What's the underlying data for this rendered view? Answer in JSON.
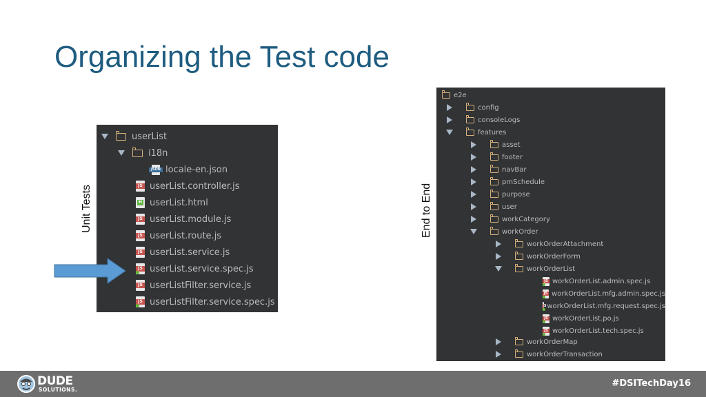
{
  "slide": {
    "title": "Organizing the Test code",
    "label_unit": "Unit Tests",
    "label_e2e": "End to End"
  },
  "panel_unit": {
    "items": [
      {
        "label": "userList",
        "icon": "folder",
        "expanded": true
      },
      {
        "label": "i18n",
        "icon": "folder",
        "expanded": true
      },
      {
        "label": "locale-en.json",
        "icon": "json-file"
      },
      {
        "label": "userList.controller.js",
        "icon": "js-file"
      },
      {
        "label": "userList.html",
        "icon": "html-file"
      },
      {
        "label": "userList.module.js",
        "icon": "js-file"
      },
      {
        "label": "userList.route.js",
        "icon": "js-file"
      },
      {
        "label": "userList.service.js",
        "icon": "js-file"
      },
      {
        "label": "userList.service.spec.js",
        "icon": "js-spec-file",
        "highlighted": true
      },
      {
        "label": "userListFilter.service.js",
        "icon": "js-file"
      },
      {
        "label": "userListFilter.service.spec.js",
        "icon": "js-spec-file"
      }
    ],
    "icon_text": {
      "js": "JS",
      "html": "H",
      "json": "JSON"
    }
  },
  "panel_e2e": {
    "items": [
      {
        "label": "e2e",
        "icon": "folder"
      },
      {
        "label": "config",
        "icon": "folder",
        "expanded": false
      },
      {
        "label": "consoleLogs",
        "icon": "folder",
        "expanded": false
      },
      {
        "label": "features",
        "icon": "folder",
        "expanded": true
      },
      {
        "label": "asset",
        "icon": "folder",
        "expanded": false
      },
      {
        "label": "footer",
        "icon": "folder",
        "expanded": false
      },
      {
        "label": "navBar",
        "icon": "folder",
        "expanded": false
      },
      {
        "label": "pmSchedule",
        "icon": "folder",
        "expanded": false
      },
      {
        "label": "purpose",
        "icon": "folder",
        "expanded": false
      },
      {
        "label": "user",
        "icon": "folder",
        "expanded": false
      },
      {
        "label": "workCategory",
        "icon": "folder",
        "expanded": false
      },
      {
        "label": "workOrder",
        "icon": "folder",
        "expanded": true
      },
      {
        "label": "workOrderAttachment",
        "icon": "folder",
        "expanded": false
      },
      {
        "label": "workOrderForm",
        "icon": "folder",
        "expanded": false
      },
      {
        "label": "workOrderList",
        "icon": "folder",
        "expanded": true
      },
      {
        "label": "workOrderList.admin.spec.js",
        "icon": "js-spec-file"
      },
      {
        "label": "workOrderList.mfg.admin.spec.js",
        "icon": "js-spec-file"
      },
      {
        "label": "workOrderList.mfg.request.spec.js",
        "icon": "js-spec-file"
      },
      {
        "label": "workOrderList.po.js",
        "icon": "js-spec-file"
      },
      {
        "label": "workOrderList.tech.spec.js",
        "icon": "js-spec-file"
      },
      {
        "label": "workOrderMap",
        "icon": "folder",
        "expanded": false
      },
      {
        "label": "workOrderTransaction",
        "icon": "folder",
        "expanded": false
      }
    ],
    "icon_text": {
      "js": "JS"
    }
  },
  "footer": {
    "logo_text": "DUDE",
    "logo_sub": "SOLUTIONS.",
    "hashtag": "#DSITechDay16"
  },
  "colors": {
    "title": "#1e5c80",
    "panel_bg": "#313335",
    "folder": "#d8b27a",
    "arrow": "#5b9bd5",
    "footer_bg": "#6e6e6e"
  }
}
